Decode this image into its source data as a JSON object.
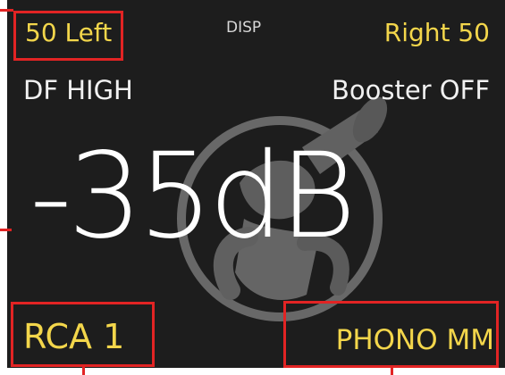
{
  "display": {
    "balance_left": "50 Left",
    "disp_label": "DISP",
    "balance_right": "Right 50",
    "df_status": "DF HIGH",
    "booster_status": "Booster OFF",
    "volume": "-35dB",
    "input_source": "RCA 1",
    "phono_mode": "PHONO MM"
  },
  "colors": {
    "background": "#1d1d1d",
    "accent_yellow": "#f3d64b",
    "text_white": "#f1f1f1",
    "annotation_red": "#e22424"
  },
  "icons": {
    "background_logo": "horn-player-logo"
  }
}
